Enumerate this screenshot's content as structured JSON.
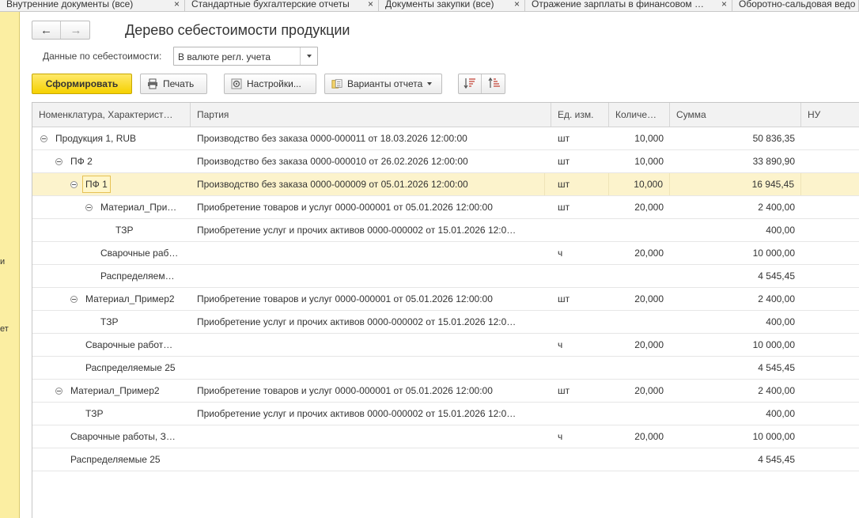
{
  "tabs": [
    {
      "label": "Внутренние документы (все)",
      "close": "×"
    },
    {
      "label": "Стандартные бухгалтерские отчеты",
      "close": "×"
    },
    {
      "label": "Документы закупки (все)",
      "close": "×"
    },
    {
      "label": "Отражение зарплаты в финансовом …",
      "close": "×"
    },
    {
      "label": "Оборотно-сальдовая ведо",
      "close": ""
    }
  ],
  "leftpanel": {
    "fragments": [
      "и",
      "ет"
    ]
  },
  "header": {
    "title": "Дерево себестоимости продукции",
    "nav_back": "←",
    "nav_forward": "→",
    "param_label": "Данные по себестоимости:",
    "param_value": "В валюте регл. учета"
  },
  "toolbar": {
    "generate": "Сформировать",
    "print": "Печать",
    "settings": "Настройки...",
    "variants": "Варианты отчета"
  },
  "icons": {
    "print": "printer-icon",
    "settings": "gear-icon",
    "variants": "report-variants-icon",
    "sort_asc": "sort-ascending-icon",
    "sort_desc": "sort-descending-icon"
  },
  "colors": {
    "accent": "#f5d100",
    "selected_row": "#fcf3cc",
    "header_bg": "#f2f2f2",
    "side_panel": "#fbeea2"
  },
  "table": {
    "columns": [
      "Номенклатура, Характерист…",
      "Партия",
      "Ед. изм.",
      "Количе…",
      "Сумма",
      "НУ"
    ],
    "rows": [
      {
        "level": 0,
        "toggle": true,
        "name": "Продукция 1, RUB",
        "batch": "Производство без заказа 0000-000011 от 18.03.2026 12:00:00",
        "unit": "шт",
        "qty": "10,000",
        "sum": "50 836,35",
        "selected": false
      },
      {
        "level": 1,
        "toggle": true,
        "name": "ПФ 2",
        "batch": "Производство без заказа 0000-000010 от 26.02.2026 12:00:00",
        "unit": "шт",
        "qty": "10,000",
        "sum": "33 890,90",
        "selected": false
      },
      {
        "level": 2,
        "toggle": true,
        "name": "ПФ 1",
        "batch": "Производство без заказа 0000-000009 от 05.01.2026 12:00:00",
        "unit": "шт",
        "qty": "10,000",
        "sum": "16 945,45",
        "selected": true
      },
      {
        "level": 3,
        "toggle": true,
        "name": "Материал_При…",
        "batch": "Приобретение товаров и услуг 0000-000001 от 05.01.2026 12:00:00",
        "unit": "шт",
        "qty": "20,000",
        "sum": "2 400,00",
        "selected": false
      },
      {
        "level": 4,
        "toggle": false,
        "name": "ТЗР",
        "batch": "Приобретение услуг и прочих активов 0000-000002 от 15.01.2026 12:0…",
        "unit": "",
        "qty": "",
        "sum": "400,00",
        "selected": false
      },
      {
        "level": 3,
        "toggle": false,
        "name": "Сварочные раб…",
        "batch": "",
        "unit": "ч",
        "qty": "20,000",
        "sum": "10 000,00",
        "selected": false
      },
      {
        "level": 3,
        "toggle": false,
        "name": "Распределяем…",
        "batch": "",
        "unit": "",
        "qty": "",
        "sum": "4 545,45",
        "selected": false
      },
      {
        "level": 2,
        "toggle": true,
        "name": "Материал_Пример2",
        "batch": "Приобретение товаров и услуг 0000-000001 от 05.01.2026 12:00:00",
        "unit": "шт",
        "qty": "20,000",
        "sum": "2 400,00",
        "selected": false
      },
      {
        "level": 3,
        "toggle": false,
        "name": "ТЗР",
        "batch": "Приобретение услуг и прочих активов 0000-000002 от 15.01.2026 12:0…",
        "unit": "",
        "qty": "",
        "sum": "400,00",
        "selected": false
      },
      {
        "level": 2,
        "toggle": false,
        "name": "Сварочные работ…",
        "batch": "",
        "unit": "ч",
        "qty": "20,000",
        "sum": "10 000,00",
        "selected": false
      },
      {
        "level": 2,
        "toggle": false,
        "name": "Распределяемые 25",
        "batch": "",
        "unit": "",
        "qty": "",
        "sum": "4 545,45",
        "selected": false
      },
      {
        "level": 1,
        "toggle": true,
        "name": "Материал_Пример2",
        "batch": "Приобретение товаров и услуг 0000-000001 от 05.01.2026 12:00:00",
        "unit": "шт",
        "qty": "20,000",
        "sum": "2 400,00",
        "selected": false
      },
      {
        "level": 2,
        "toggle": false,
        "name": "ТЗР",
        "batch": "Приобретение услуг и прочих активов 0000-000002 от 15.01.2026 12:0…",
        "unit": "",
        "qty": "",
        "sum": "400,00",
        "selected": false
      },
      {
        "level": 1,
        "toggle": false,
        "name": "Сварочные работы, З…",
        "batch": "",
        "unit": "ч",
        "qty": "20,000",
        "sum": "10 000,00",
        "selected": false
      },
      {
        "level": 1,
        "toggle": false,
        "name": "Распределяемые 25",
        "batch": "",
        "unit": "",
        "qty": "",
        "sum": "4 545,45",
        "selected": false
      }
    ]
  }
}
